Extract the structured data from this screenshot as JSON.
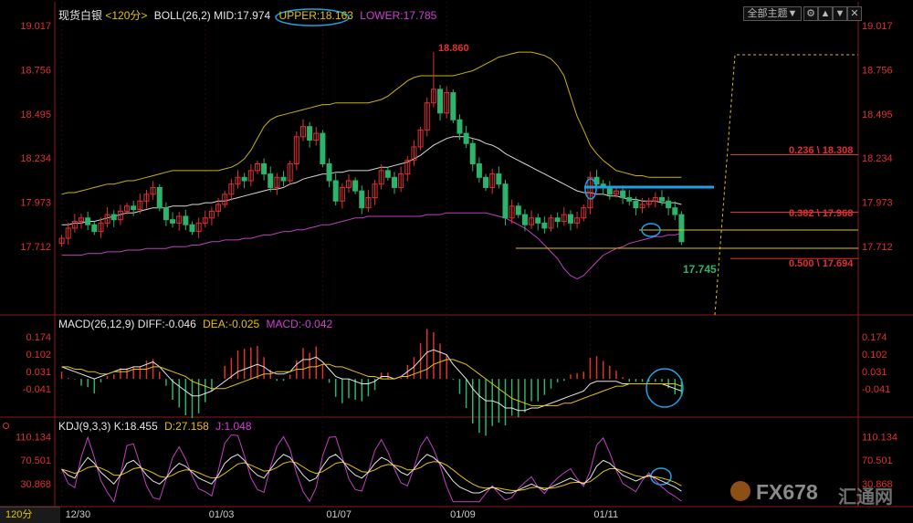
{
  "header": {
    "symbol": "现货白银",
    "period": "<120分>",
    "boll_name": "BOLL(26,2)",
    "mid": "MID:17.974",
    "upper": "UPPER:18.163",
    "lower": "LOWER:17.785",
    "theme": "全部主题▼",
    "icons": [
      "gear-icon",
      "chevron-up-icon",
      "chevron-down-icon",
      "close-icon"
    ]
  },
  "macd_header": {
    "name": "MACD(26,12,9)",
    "diff": "DIFF:-0.046",
    "dea": "DEA:-0.025",
    "macd": "MACD:-0.042"
  },
  "kdj_header": {
    "name": "KDJ(9,3,3)",
    "k": "K:18.455",
    "d": "D:27.158",
    "j": "J:1.048"
  },
  "period_button": "120分",
  "watermark": {
    "brand": "FX678",
    "cn": "汇通网"
  },
  "colors": {
    "up": "#e03030",
    "down": "#2db36b",
    "mid": "#d8d8d8",
    "upper": "#c8b400",
    "lower": "#c040c0",
    "annotation": "#1ea0e6"
  },
  "chart_data": {
    "type": "candlestick",
    "price_ticks": [
      "19.017",
      "18.756",
      "18.495",
      "18.234",
      "17.973",
      "17.712"
    ],
    "price_ylim": [
      17.55,
      19.06
    ],
    "x_labels": [
      "12/30",
      "01/03",
      "01/07",
      "01/09",
      "01/11"
    ],
    "high_label": "18.860",
    "last_label": "17.745",
    "fib_levels": [
      {
        "label": "0.236 \\ 18.308",
        "value": 18.308
      },
      {
        "label": "0.382 \\ 17.968",
        "value": 17.968
      },
      {
        "label": "0.500 \\ 17.694",
        "value": 17.694
      }
    ],
    "closes": [
      17.76,
      17.82,
      17.86,
      17.88,
      17.84,
      17.8,
      17.85,
      17.9,
      17.87,
      17.92,
      17.95,
      17.93,
      17.98,
      18.02,
      18.06,
      17.94,
      17.87,
      17.85,
      17.89,
      17.84,
      17.8,
      17.85,
      17.88,
      17.92,
      17.96,
      18.02,
      18.08,
      18.12,
      18.1,
      18.16,
      18.2,
      18.14,
      18.06,
      18.12,
      18.1,
      18.2,
      18.36,
      18.42,
      18.34,
      18.38,
      18.2,
      18.1,
      17.98,
      18.06,
      18.1,
      18.04,
      17.94,
      18.0,
      18.08,
      18.16,
      18.12,
      18.06,
      18.14,
      18.22,
      18.3,
      18.4,
      18.56,
      18.64,
      18.5,
      18.62,
      18.46,
      18.38,
      18.32,
      18.2,
      18.12,
      18.06,
      18.14,
      18.08,
      17.88,
      17.95,
      17.9,
      17.84,
      17.88,
      17.85,
      17.82,
      17.88,
      17.86,
      17.9,
      17.85,
      17.88,
      17.94,
      18.12,
      18.08,
      18.06,
      18.02,
      18.04,
      18.0,
      17.98,
      17.94,
      17.96,
      17.98,
      18.0,
      17.98,
      17.94,
      17.9,
      17.74
    ],
    "boll_mid": [
      17.84,
      17.84,
      17.85,
      17.85,
      17.86,
      17.86,
      17.87,
      17.88,
      17.89,
      17.9,
      17.91,
      17.91,
      17.92,
      17.93,
      17.94,
      17.94,
      17.94,
      17.95,
      17.95,
      17.95,
      17.96,
      17.96,
      17.97,
      17.97,
      17.98,
      17.98,
      17.99,
      18.0,
      18.01,
      18.02,
      18.03,
      18.04,
      18.05,
      18.05,
      18.06,
      18.08,
      18.09,
      18.11,
      18.12,
      18.13,
      18.14,
      18.14,
      18.15,
      18.15,
      18.16,
      18.16,
      18.16,
      18.16,
      18.17,
      18.18,
      18.18,
      18.19,
      18.2,
      18.21,
      18.23,
      18.25,
      18.28,
      18.31,
      18.33,
      18.35,
      18.36,
      18.36,
      18.36,
      18.35,
      18.34,
      18.32,
      18.31,
      18.29,
      18.26,
      18.24,
      18.22,
      18.2,
      18.18,
      18.16,
      18.14,
      18.12,
      18.1,
      18.08,
      18.06,
      18.04,
      18.03,
      18.03,
      18.02,
      18.02,
      18.01,
      18.01,
      18.0,
      17.99,
      17.99,
      17.98,
      17.98,
      17.98,
      17.97,
      17.97,
      17.97,
      17.96
    ],
    "boll_upper": [
      18.02,
      18.03,
      18.03,
      18.04,
      18.05,
      18.06,
      18.07,
      18.08,
      18.08,
      18.09,
      18.1,
      18.1,
      18.11,
      18.12,
      18.13,
      18.14,
      18.15,
      18.16,
      18.16,
      18.16,
      18.16,
      18.16,
      18.16,
      18.16,
      18.16,
      18.17,
      18.18,
      18.2,
      18.23,
      18.28,
      18.35,
      18.42,
      18.46,
      18.48,
      18.49,
      18.5,
      18.51,
      18.52,
      18.53,
      18.54,
      18.55,
      18.55,
      18.56,
      18.56,
      18.56,
      18.56,
      18.56,
      18.56,
      18.57,
      18.58,
      18.6,
      18.63,
      18.66,
      18.69,
      18.71,
      18.72,
      18.72,
      18.72,
      18.72,
      18.72,
      18.72,
      18.73,
      18.74,
      18.75,
      18.77,
      18.79,
      18.81,
      18.83,
      18.84,
      18.85,
      18.86,
      18.86,
      18.86,
      18.85,
      18.84,
      18.82,
      18.78,
      18.72,
      18.6,
      18.48,
      18.4,
      18.31,
      18.26,
      18.22,
      18.19,
      18.16,
      18.15,
      18.14,
      18.13,
      18.13,
      18.12,
      18.12,
      18.12,
      18.12,
      18.12,
      18.12
    ],
    "boll_lower": [
      17.66,
      17.66,
      17.66,
      17.66,
      17.67,
      17.67,
      17.67,
      17.68,
      17.68,
      17.68,
      17.69,
      17.69,
      17.69,
      17.7,
      17.7,
      17.7,
      17.7,
      17.71,
      17.71,
      17.71,
      17.72,
      17.72,
      17.73,
      17.74,
      17.74,
      17.75,
      17.75,
      17.75,
      17.76,
      17.76,
      17.77,
      17.78,
      17.78,
      17.79,
      17.8,
      17.8,
      17.81,
      17.81,
      17.82,
      17.83,
      17.84,
      17.84,
      17.85,
      17.86,
      17.87,
      17.88,
      17.88,
      17.89,
      17.89,
      17.89,
      17.89,
      17.89,
      17.89,
      17.89,
      17.89,
      17.89,
      17.9,
      17.9,
      17.9,
      17.91,
      17.91,
      17.91,
      17.91,
      17.91,
      17.91,
      17.91,
      17.9,
      17.89,
      17.88,
      17.86,
      17.84,
      17.82,
      17.79,
      17.76,
      17.72,
      17.68,
      17.64,
      17.58,
      17.54,
      17.52,
      17.54,
      17.58,
      17.62,
      17.66,
      17.68,
      17.7,
      17.71,
      17.73,
      17.74,
      17.75,
      17.76,
      17.77,
      17.77,
      17.78,
      17.78,
      17.79
    ],
    "macd_ticks": [
      "0.174",
      "0.102",
      "0.031",
      "-0.041"
    ],
    "macd_ylim": [
      -0.15,
      0.2
    ],
    "macd_diff": [
      0.05,
      0.04,
      0.03,
      0.02,
      0.01,
      0.0,
      0.01,
      0.02,
      0.03,
      0.04,
      0.04,
      0.05,
      0.05,
      0.06,
      0.07,
      0.05,
      0.02,
      -0.01,
      -0.03,
      -0.05,
      -0.07,
      -0.07,
      -0.06,
      -0.05,
      -0.03,
      -0.01,
      0.01,
      0.03,
      0.04,
      0.05,
      0.06,
      0.05,
      0.03,
      0.02,
      0.02,
      0.03,
      0.06,
      0.08,
      0.08,
      0.09,
      0.07,
      0.04,
      0.01,
      0.0,
      0.0,
      -0.01,
      -0.02,
      -0.02,
      -0.01,
      0.01,
      0.01,
      0.0,
      0.01,
      0.03,
      0.05,
      0.08,
      0.11,
      0.12,
      0.11,
      0.1,
      0.06,
      0.03,
      0.0,
      -0.04,
      -0.07,
      -0.09,
      -0.09,
      -0.1,
      -0.12,
      -0.12,
      -0.13,
      -0.13,
      -0.12,
      -0.12,
      -0.11,
      -0.1,
      -0.09,
      -0.08,
      -0.07,
      -0.06,
      -0.05,
      -0.02,
      -0.01,
      -0.01,
      -0.01,
      -0.01,
      -0.02,
      -0.02,
      -0.02,
      -0.02,
      -0.02,
      -0.02,
      -0.02,
      -0.03,
      -0.04,
      -0.05
    ],
    "macd_dea": [
      0.05,
      0.05,
      0.04,
      0.04,
      0.03,
      0.03,
      0.02,
      0.02,
      0.03,
      0.03,
      0.03,
      0.04,
      0.04,
      0.04,
      0.05,
      0.05,
      0.04,
      0.03,
      0.02,
      0.01,
      -0.01,
      -0.02,
      -0.03,
      -0.04,
      -0.04,
      -0.04,
      -0.03,
      -0.02,
      -0.01,
      0.0,
      0.01,
      0.02,
      0.02,
      0.03,
      0.03,
      0.03,
      0.04,
      0.04,
      0.05,
      0.05,
      0.06,
      0.06,
      0.05,
      0.05,
      0.04,
      0.03,
      0.02,
      0.01,
      0.01,
      0.0,
      0.0,
      0.0,
      0.01,
      0.01,
      0.02,
      0.03,
      0.04,
      0.06,
      0.07,
      0.08,
      0.08,
      0.07,
      0.06,
      0.04,
      0.02,
      0.0,
      -0.02,
      -0.04,
      -0.06,
      -0.08,
      -0.09,
      -0.1,
      -0.11,
      -0.11,
      -0.11,
      -0.11,
      -0.11,
      -0.1,
      -0.1,
      -0.09,
      -0.08,
      -0.07,
      -0.06,
      -0.05,
      -0.04,
      -0.03,
      -0.03,
      -0.02,
      -0.02,
      -0.02,
      -0.02,
      -0.02,
      -0.02,
      -0.02,
      -0.02,
      -0.03
    ],
    "kdj_ticks": [
      "110.134",
      "70.501",
      "30.868"
    ],
    "kdj_ylim": [
      -5,
      120
    ],
    "kdj_k": [
      55,
      45,
      40,
      60,
      75,
      65,
      50,
      40,
      30,
      45,
      65,
      70,
      60,
      45,
      35,
      30,
      40,
      55,
      65,
      60,
      50,
      40,
      35,
      30,
      45,
      65,
      75,
      80,
      70,
      55,
      45,
      40,
      55,
      70,
      80,
      75,
      60,
      45,
      35,
      40,
      60,
      75,
      80,
      70,
      55,
      45,
      40,
      50,
      65,
      75,
      70,
      60,
      50,
      45,
      55,
      70,
      80,
      75,
      65,
      50,
      35,
      25,
      20,
      15,
      15,
      20,
      25,
      20,
      15,
      15,
      20,
      25,
      30,
      25,
      20,
      25,
      30,
      35,
      40,
      35,
      30,
      40,
      60,
      70,
      65,
      55,
      45,
      40,
      35,
      40,
      45,
      40,
      35,
      30,
      25,
      18
    ],
    "kdj_d": [
      55,
      52,
      48,
      52,
      58,
      60,
      57,
      52,
      45,
      45,
      50,
      56,
      58,
      54,
      49,
      43,
      41,
      45,
      51,
      54,
      53,
      49,
      44,
      40,
      41,
      48,
      56,
      64,
      66,
      62,
      57,
      52,
      53,
      58,
      65,
      68,
      66,
      59,
      52,
      48,
      51,
      58,
      65,
      67,
      63,
      57,
      51,
      50,
      54,
      60,
      63,
      62,
      59,
      54,
      54,
      58,
      65,
      68,
      67,
      62,
      54,
      45,
      37,
      30,
      25,
      23,
      24,
      23,
      21,
      19,
      19,
      21,
      24,
      25,
      23,
      23,
      25,
      28,
      32,
      33,
      32,
      34,
      42,
      51,
      56,
      56,
      52,
      48,
      44,
      42,
      43,
      42,
      40,
      37,
      33,
      27
    ],
    "kdj_j": [
      55,
      31,
      24,
      76,
      109,
      75,
      36,
      16,
      0,
      45,
      95,
      98,
      64,
      27,
      7,
      4,
      38,
      75,
      93,
      72,
      44,
      22,
      17,
      10,
      53,
      99,
      113,
      112,
      78,
      41,
      21,
      16,
      59,
      94,
      110,
      89,
      48,
      17,
      1,
      24,
      78,
      109,
      110,
      76,
      39,
      21,
      18,
      50,
      87,
      105,
      84,
      56,
      32,
      27,
      57,
      94,
      110,
      89,
      61,
      26,
      0,
      0,
      0,
      0,
      0,
      14,
      27,
      14,
      3,
      7,
      22,
      33,
      42,
      25,
      14,
      29,
      40,
      49,
      56,
      39,
      26,
      52,
      96,
      108,
      83,
      53,
      31,
      24,
      17,
      36,
      49,
      36,
      25,
      16,
      9,
      1
    ]
  }
}
